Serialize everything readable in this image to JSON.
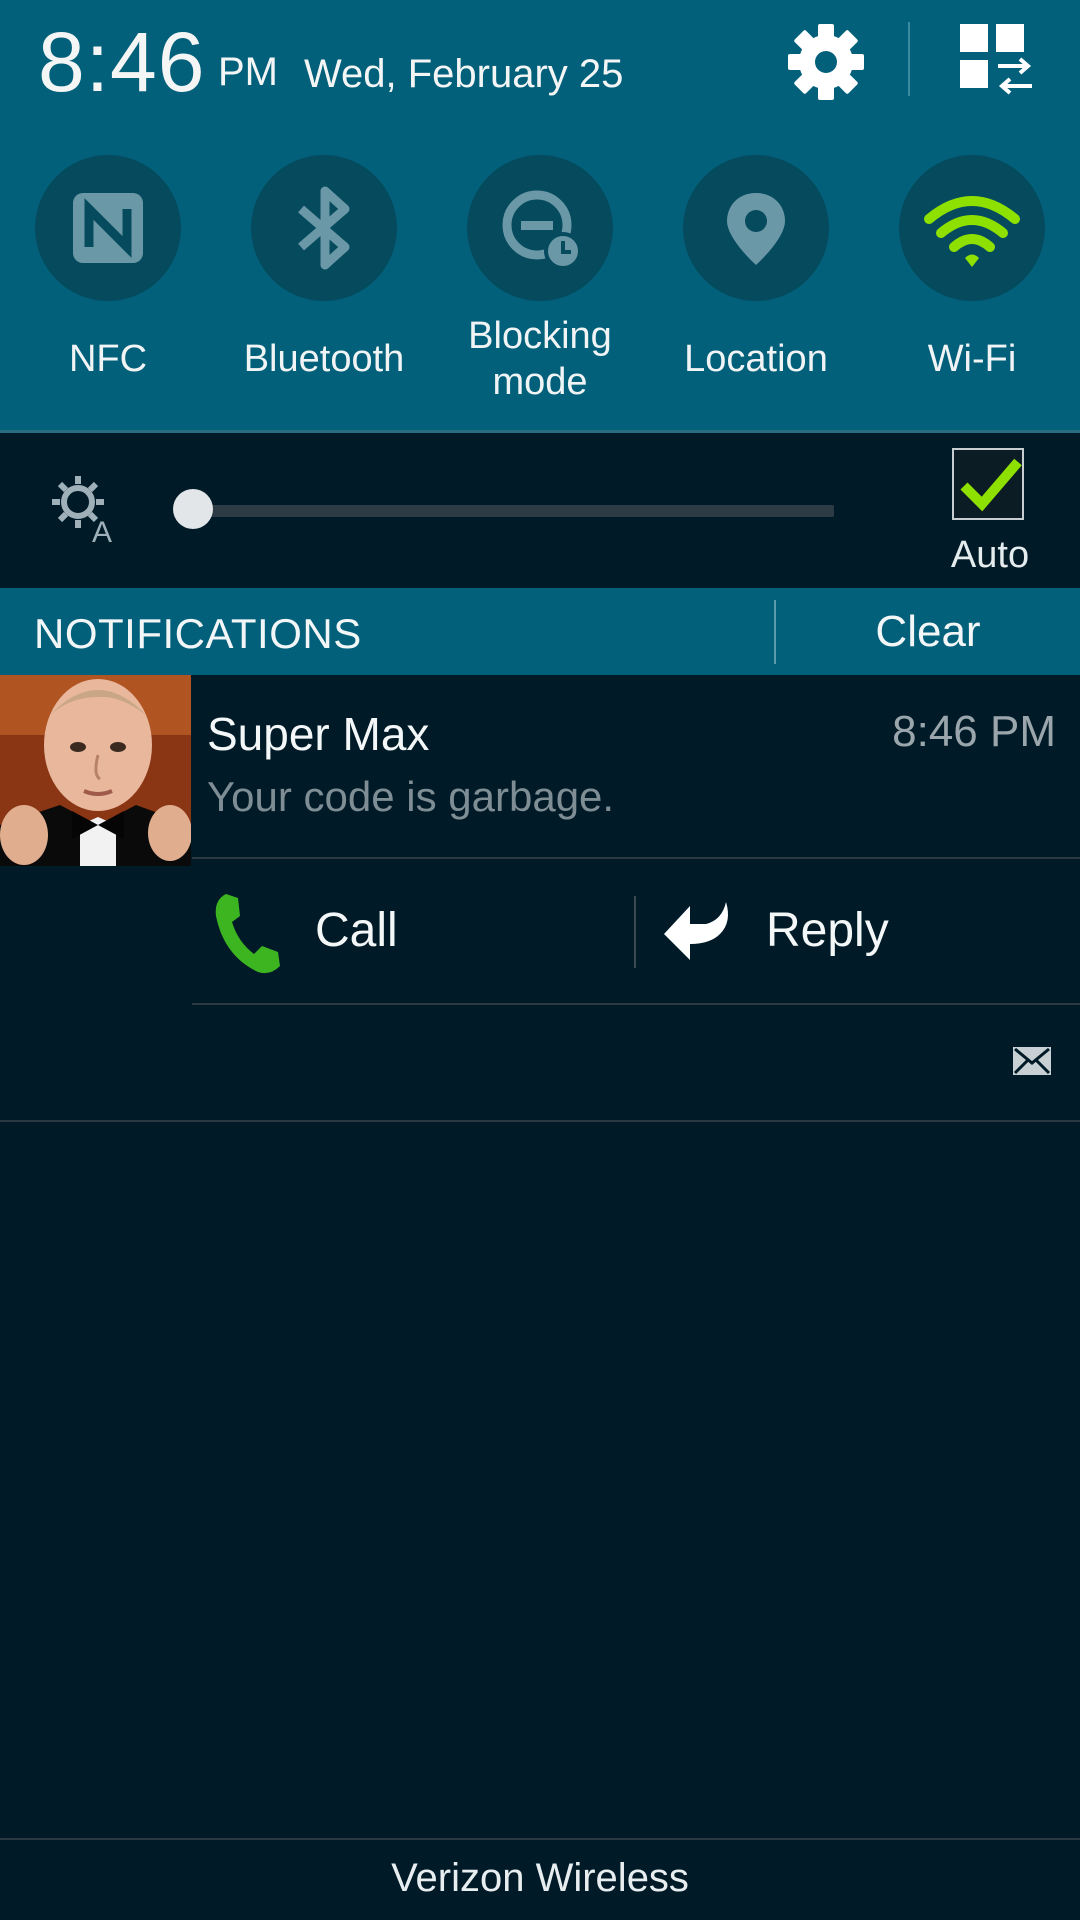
{
  "status": {
    "time": "8:46",
    "ampm": "PM",
    "date": "Wed, February 25"
  },
  "quick_toggles": [
    {
      "label": "NFC",
      "icon": "nfc-icon",
      "active": false
    },
    {
      "label": "Bluetooth",
      "icon": "bluetooth-icon",
      "active": false
    },
    {
      "label": "Blocking mode",
      "icon": "blocking-mode-icon",
      "active": false
    },
    {
      "label": "Location",
      "icon": "location-pin-icon",
      "active": false
    },
    {
      "label": "Wi-Fi",
      "icon": "wifi-icon",
      "active": true
    }
  ],
  "brightness": {
    "level": 0,
    "auto_label": "Auto",
    "auto_checked": true
  },
  "notifications": {
    "title": "NOTIFICATIONS",
    "clear_label": "Clear",
    "items": [
      {
        "sender": "Super Max",
        "time": "8:46 PM",
        "message": "Your code is garbage.",
        "actions": [
          "Call",
          "Reply"
        ]
      }
    ]
  },
  "carrier": "Verizon Wireless",
  "colors": {
    "header": "#02607a",
    "background": "#001b27",
    "accent_green": "#8ee000",
    "toggle_off": "#064a5e"
  }
}
